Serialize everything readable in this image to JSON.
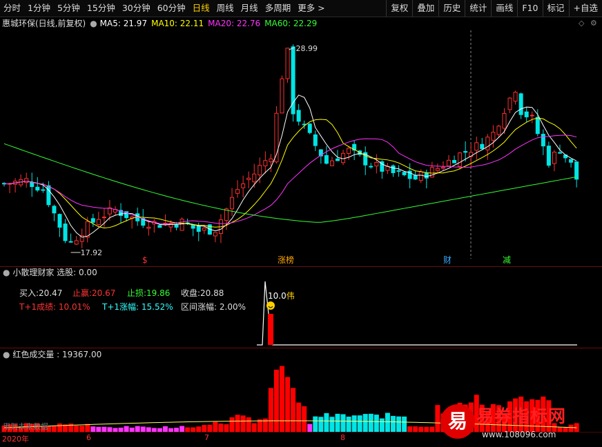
{
  "toolbar": {
    "periods": [
      "分时",
      "1分钟",
      "5分钟",
      "15分钟",
      "30分钟",
      "60分钟",
      "日线",
      "周线",
      "月线",
      "多周期",
      "更多 >"
    ],
    "active": "日线",
    "buttons": [
      "复权",
      "叠加",
      "历史",
      "统计",
      "画线",
      "F10",
      "标记",
      "+自选"
    ]
  },
  "title": {
    "stock": "惠城环保(日线,前复权)",
    "ma5": "MA5: 21.97",
    "ma10": "MA10: 22.11",
    "ma20": "MA20: 22.76",
    "ma60": "MA60: 22.29",
    "colors": {
      "ma5": "#ffffff",
      "ma10": "#ffff00",
      "ma20": "#ff33ff",
      "ma60": "#33ff33"
    }
  },
  "main_chart": {
    "high_label": "28.99",
    "low_label": "17.92",
    "markers": [
      {
        "text": "$",
        "color": "#ff3333"
      },
      {
        "text": "涨榜",
        "color": "#ffa500"
      },
      {
        "text": "财",
        "color": "#33aaff"
      },
      {
        "text": "减",
        "color": "#33ff33"
      }
    ]
  },
  "indicator1": {
    "title": "小散理财家 选股: 0.00",
    "buy_label": "买入:",
    "buy_value": "20.47",
    "tp_label": "止赢:",
    "tp_value": "20.67",
    "sl_label": "止损:",
    "sl_value": "19.86",
    "close_label": "收盘:",
    "close_value": "20.88",
    "t1_result_label": "T+1成绩:",
    "t1_result_value": "10.01%",
    "t1_rise_label": "T+1涨幅:",
    "t1_rise_value": "15.52%",
    "range_label": "区间涨幅:",
    "range_value": "2.00%",
    "peak_label": "10.0",
    "peak_suffix": "伟"
  },
  "indicator2": {
    "title": "红色成交量 : 19367.00",
    "bottom_left": "用到未来数据"
  },
  "time_axis": {
    "labels": [
      "2020年",
      "6",
      "7",
      "8"
    ]
  },
  "watermark": {
    "logo_char": "易",
    "brand": "易券指标网",
    "url": "www.108096.com"
  }
}
